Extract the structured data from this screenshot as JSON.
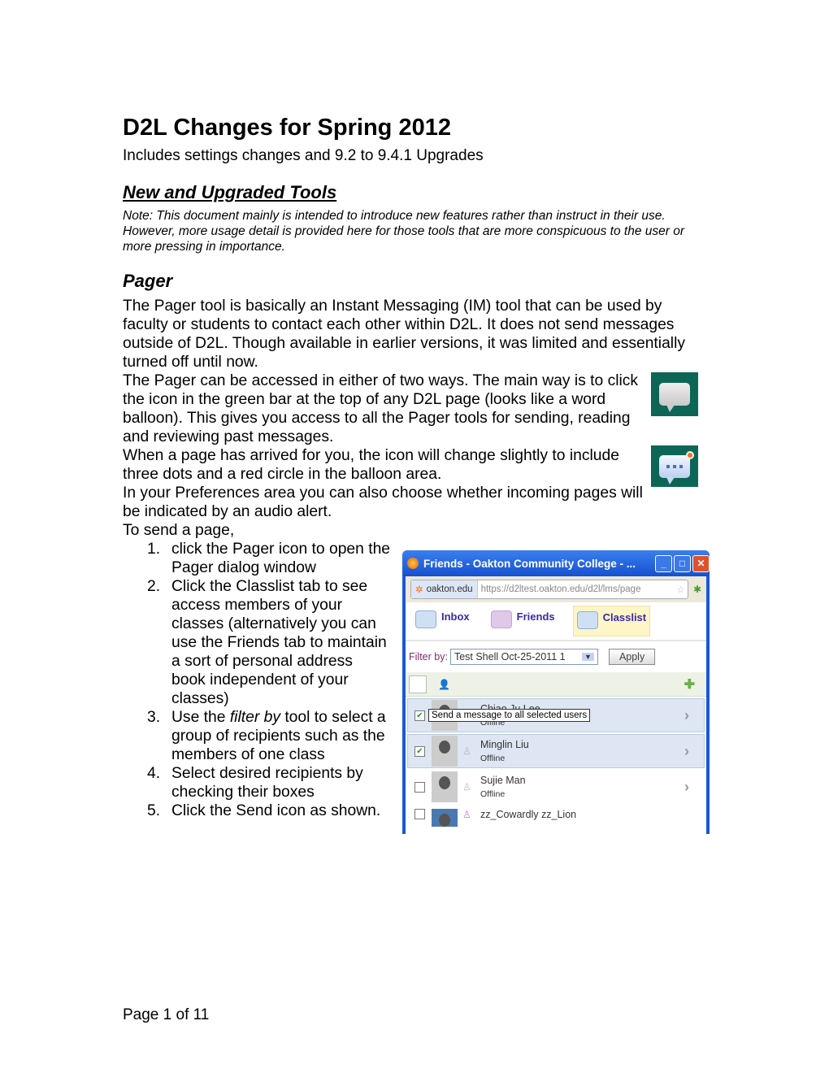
{
  "title": "D2L Changes for Spring 2012",
  "subtitle": "Includes settings changes and 9.2 to 9.4.1 Upgrades",
  "section_heading": "New and Upgraded Tools",
  "note": "Note: This document mainly is intended to introduce new features rather than instruct in their use. However, more usage detail is provided here for those tools that are more conspicuous to the user or more pressing in importance.",
  "pager": {
    "heading": "Pager",
    "p1": "The Pager tool is basically an Instant Messaging (IM) tool that can be used by faculty or students to contact each other within D2L. It does not send messages outside of D2L. Though available in earlier versions, it was limited and essentially turned off until now.",
    "p2": "The Pager can be accessed in either of two ways. The main way is to click the icon in the green bar at the top of any D2L page (looks like a word balloon). This gives you access to all the Pager tools for sending, reading and reviewing past messages.",
    "p3": "When a page has arrived for you, the icon will change slightly to include three dots and a red circle in the balloon area.",
    "p4": "In your Preferences area you can also choose whether incoming pages will be indicated by an audio alert.",
    "p5": "To send a page,",
    "steps": [
      {
        "num": "1.",
        "pre": "click the Pager icon to open the Pager dialog window",
        "em": "",
        "post": ""
      },
      {
        "num": "2.",
        "pre": "Click the Classlist tab to see access members of your classes (alternatively you can use the Friends tab to maintain a sort of personal address book independent of your classes)",
        "em": "",
        "post": ""
      },
      {
        "num": "3.",
        "pre": "Use the ",
        "em": "filter by",
        "post": " tool to select a group of recipients such as the members of one class"
      },
      {
        "num": "4.",
        "pre": "Select desired recipients by checking their boxes",
        "em": "",
        "post": ""
      },
      {
        "num": "5.",
        "pre": "Click the Send icon as shown.",
        "em": "",
        "post": ""
      }
    ]
  },
  "screenshot": {
    "window_title": "Friends - Oakton Community College - ...",
    "site": "oakton.edu",
    "url": "https://d2ltest.oakton.edu/d2l/lms/page",
    "tabs": [
      "Inbox",
      "Friends",
      "Classlist"
    ],
    "filter_label": "Filter by:",
    "filter_value": "Test Shell Oct-25-2011 1",
    "apply": "Apply",
    "tooltip": "Send a message to all selected users",
    "users": [
      {
        "name": "Chiao Ju Lee",
        "status": "Offline",
        "checked": true
      },
      {
        "name": "Minglin Liu",
        "status": "Offline",
        "checked": true
      },
      {
        "name": "Sujie Man",
        "status": "Offline",
        "checked": false
      },
      {
        "name": "zz_Cowardly zz_Lion",
        "status": "",
        "checked": false
      }
    ]
  },
  "footer": "Page 1 of 11",
  "colors": {
    "pager_icon_bg": "#0d6655",
    "titlebar": "#1a58d4",
    "tab_text": "#3a2aa8"
  }
}
